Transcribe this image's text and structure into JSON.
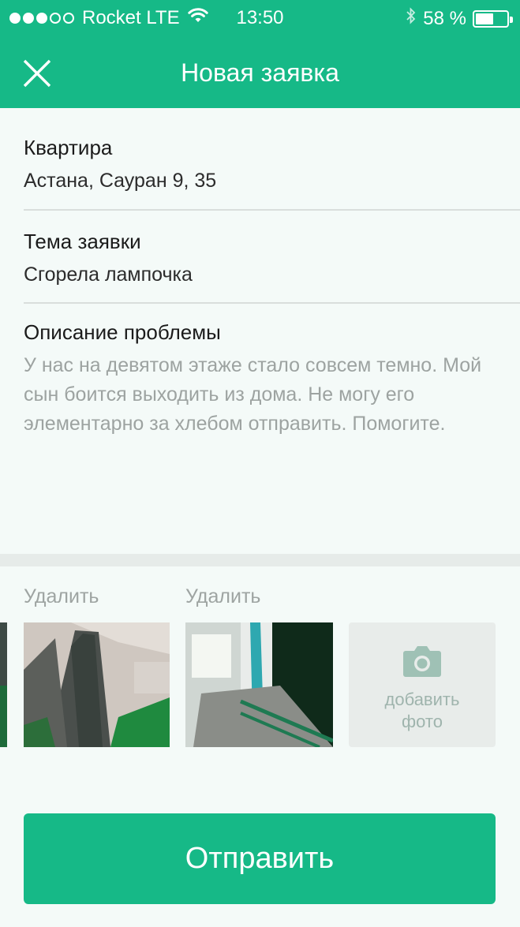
{
  "status_bar": {
    "carrier": "Rocket LTE",
    "time": "13:50",
    "battery": "58 %",
    "battery_level": 0.58,
    "signal_bars": 3,
    "signal_total": 5
  },
  "nav": {
    "title": "Новая заявка",
    "close_icon": "close-icon"
  },
  "form": {
    "apartment": {
      "label": "Квартира",
      "value": "Астана, Сауран 9, 35"
    },
    "topic": {
      "label": "Тема заявки",
      "value": "Сгорела лампочка"
    },
    "description": {
      "label": "Описание проблемы",
      "value": "У нас на девятом этаже стало совсем темно. Мой сын боится выходить из дома. Не могу его элементарно за хлебом отправить. Помогите."
    }
  },
  "photos": {
    "items": [
      {
        "delete_label": "Удалить"
      },
      {
        "delete_label": "Удалить"
      }
    ],
    "add_label_line1": "добавить",
    "add_label_line2": "фото",
    "add_icon": "camera-icon"
  },
  "submit": {
    "label": "Отправить"
  },
  "colors": {
    "accent": "#16b987",
    "background": "#f4faf8"
  }
}
